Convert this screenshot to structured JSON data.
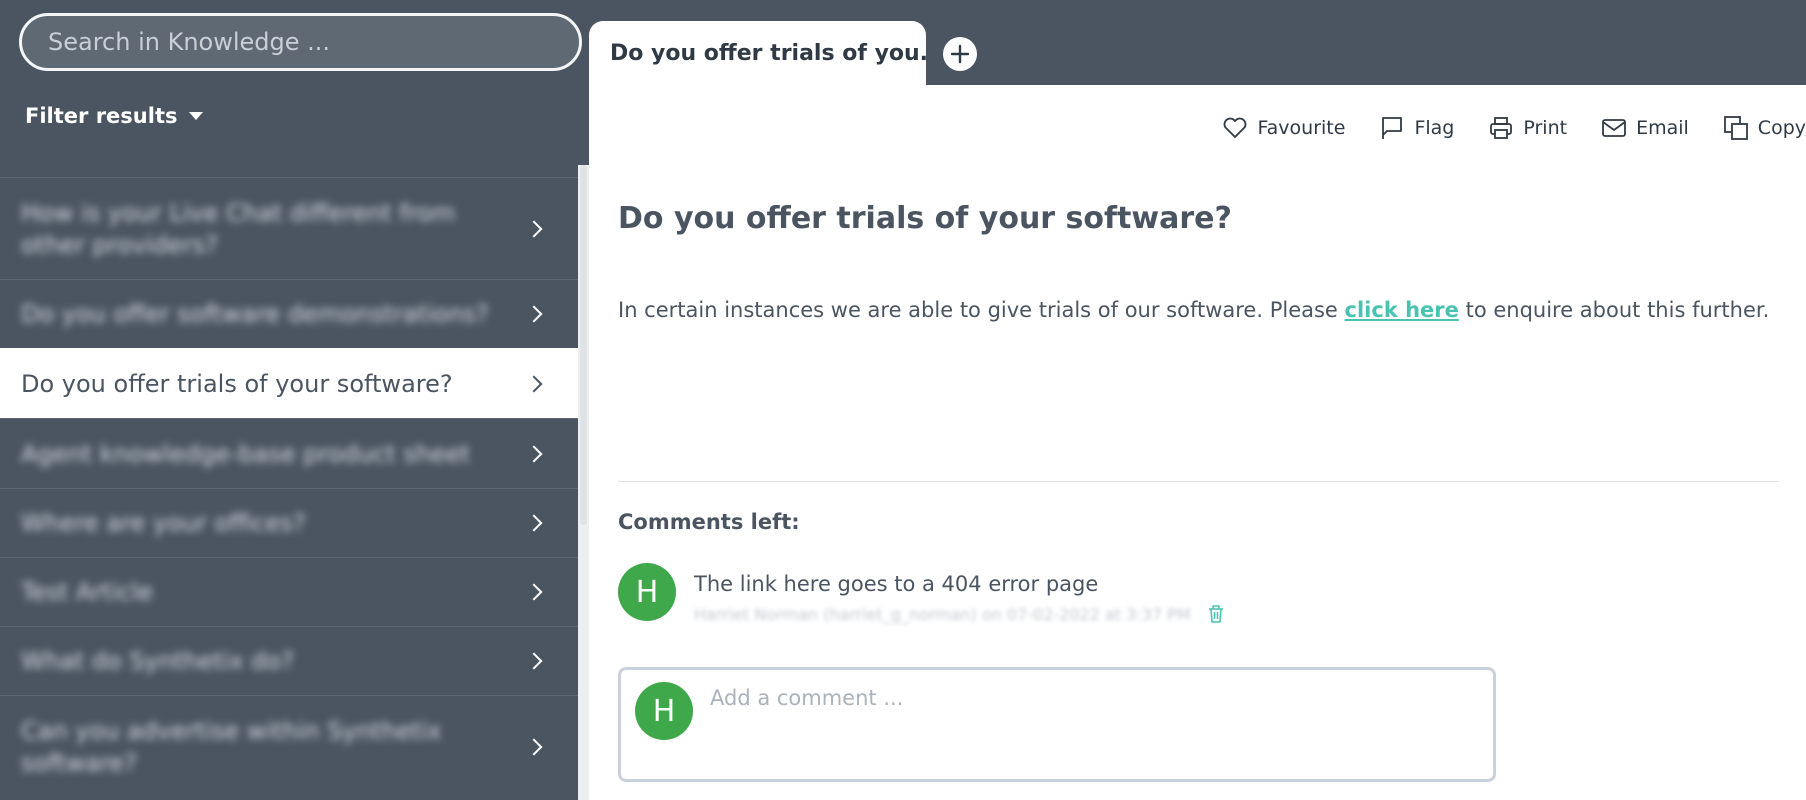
{
  "search": {
    "placeholder": "Search in Knowledge ..."
  },
  "filter": {
    "label": "Filter results"
  },
  "sidebar": {
    "items": [
      {
        "label": "How is your Live Chat different from other providers?"
      },
      {
        "label": "Do you offer software demonstrations?"
      },
      {
        "label": "Do you offer trials of your software?",
        "active": true
      },
      {
        "label": "Agent knowledge-base product sheet"
      },
      {
        "label": "Where are your offices?"
      },
      {
        "label": "Test Article"
      },
      {
        "label": "What do Synthetix do?"
      },
      {
        "label": "Can you advertise within Synthetix software?"
      }
    ]
  },
  "tabs": [
    {
      "label": "Do you offer trials of you..."
    }
  ],
  "toolbar": {
    "favourite": "Favourite",
    "flag": "Flag",
    "print": "Print",
    "email": "Email",
    "copy": "Copy"
  },
  "article": {
    "title": "Do you offer trials of your software?",
    "body_before": "In certain instances we are able to give trials of our software. Please ",
    "link_text": "click here",
    "body_after": " to enquire about this further."
  },
  "comments": {
    "label": "Comments left:",
    "items": [
      {
        "avatar": "H",
        "text": "The link here goes to a 404 error page",
        "meta": "Harriet Norman (harriet_g_norman) on 07-02-2022 at 3:37 PM"
      }
    ],
    "input": {
      "avatar": "H",
      "placeholder": "Add a comment ..."
    }
  },
  "colors": {
    "sidebar_bg": "#4a5561",
    "accent": "#49c3b1",
    "avatar_bg": "#3ea84a",
    "text": "#4a5561"
  }
}
